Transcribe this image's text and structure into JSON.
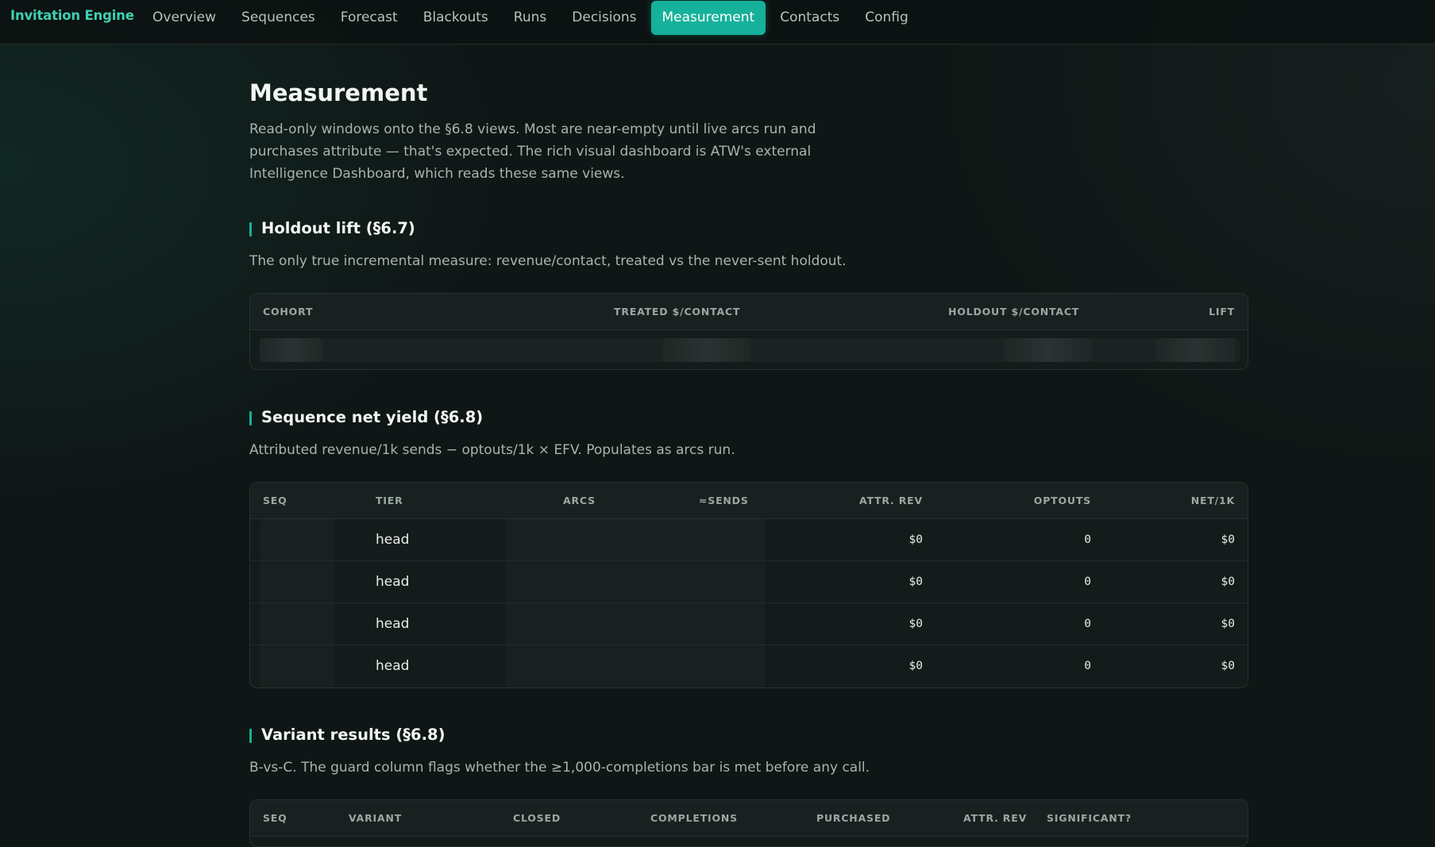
{
  "nav": {
    "brand": "Invitation Engine",
    "items": [
      {
        "label": "Overview"
      },
      {
        "label": "Sequences"
      },
      {
        "label": "Forecast"
      },
      {
        "label": "Blackouts"
      },
      {
        "label": "Runs"
      },
      {
        "label": "Decisions"
      },
      {
        "label": "Measurement",
        "active": true
      },
      {
        "label": "Contacts"
      },
      {
        "label": "Config"
      }
    ]
  },
  "page": {
    "title": "Measurement",
    "description": "Read-only windows onto the §6.8 views. Most are near-empty until live arcs run and purchases attribute — that's expected. The rich visual dashboard is ATW's external Intelligence Dashboard, which reads these same views."
  },
  "holdout": {
    "title": "Holdout lift (§6.7)",
    "description": "The only true incremental measure: revenue/contact, treated vs the never-sent holdout.",
    "columns": [
      "COHORT",
      "TREATED $/CONTACT",
      "HOLDOUT $/CONTACT",
      "LIFT"
    ]
  },
  "net_yield": {
    "title": "Sequence net yield (§6.8)",
    "description": "Attributed revenue/1k sends − optouts/1k × EFV. Populates as arcs run.",
    "columns": [
      "SEQ",
      "TIER",
      "ARCS",
      "≈SENDS",
      "ATTR. REV",
      "OPTOUTS",
      "NET/1K"
    ],
    "rows": [
      {
        "tier": "head",
        "attr_rev": "$0",
        "optouts": "0",
        "net": "$0"
      },
      {
        "tier": "head",
        "attr_rev": "$0",
        "optouts": "0",
        "net": "$0"
      },
      {
        "tier": "head",
        "attr_rev": "$0",
        "optouts": "0",
        "net": "$0"
      },
      {
        "tier": "head",
        "attr_rev": "$0",
        "optouts": "0",
        "net": "$0"
      }
    ]
  },
  "variants": {
    "title": "Variant results (§6.8)",
    "description": "B-vs-C. The guard column flags whether the ≥1,000-completions bar is met before any call.",
    "columns": [
      "SEQ",
      "VARIANT",
      "CLOSED",
      "COMPLETIONS",
      "PURCHASED",
      "ATTR. REV",
      "SIGNIFICANT?"
    ]
  }
}
